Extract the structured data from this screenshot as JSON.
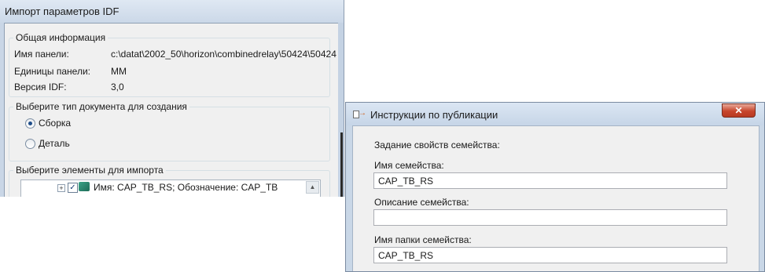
{
  "idf_dialog": {
    "title": "Импорт параметров IDF",
    "general_group": {
      "caption": "Общая информация",
      "rows": [
        {
          "label": "Имя панели:",
          "value": "c:\\datat\\2002_50\\horizon\\combinedrelay\\50424\\50424"
        },
        {
          "label": "Единицы панели:",
          "value": "MM"
        },
        {
          "label": "Версия IDF:",
          "value": "3,0"
        }
      ]
    },
    "doc_type_group": {
      "caption": "Выберите тип документа для создания",
      "options": [
        {
          "label": "Сборка",
          "selected": true
        },
        {
          "label": "Деталь",
          "selected": false
        }
      ]
    },
    "elements_group": {
      "caption": "Выберите элементы для импорта",
      "tree_item": "Имя: CAP_TB_RS;  Обозначение: CAP_TB",
      "checked": true
    }
  },
  "publish_dialog": {
    "title": "Инструкции по публикации",
    "close_glyph": "✕",
    "section_heading": "Задание свойств семейства:",
    "fields": [
      {
        "label": "Имя семейства:",
        "value": "CAP_TB_RS"
      },
      {
        "label": "Описание семейства:",
        "value": ""
      },
      {
        "label": "Имя папки семейства:",
        "value": "CAP_TB_RS"
      }
    ]
  },
  "colors": {
    "title_bar": "#cbd8e8",
    "client_bg": "#f0f0f0",
    "close_button": "#c7452c",
    "radio_dot": "#1f4d8a"
  }
}
